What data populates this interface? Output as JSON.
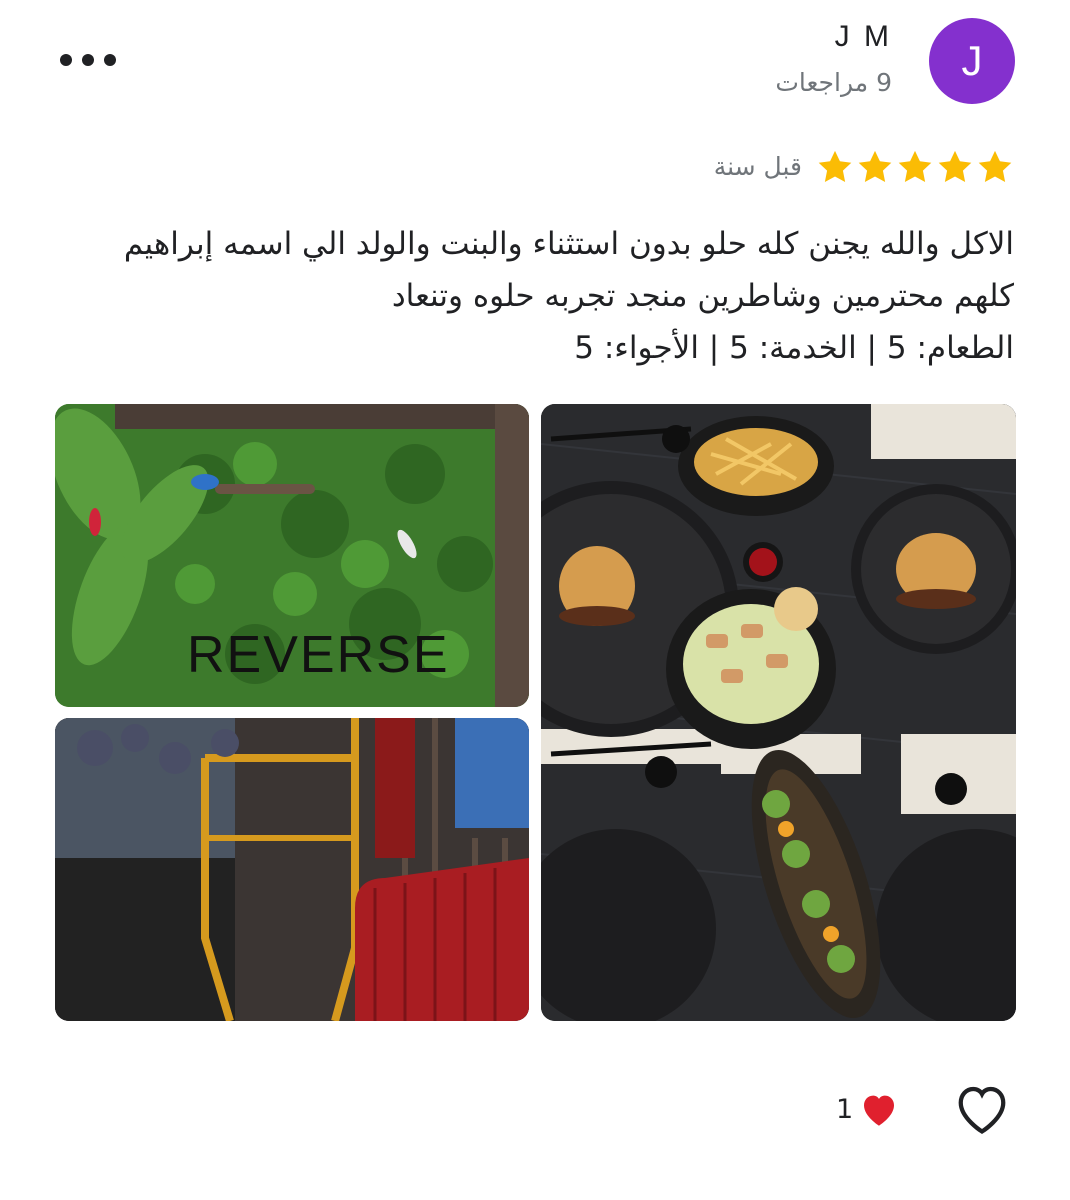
{
  "author": {
    "initial": "J",
    "name": "J M",
    "meta": "9 مراجعات",
    "avatar_color": "#8430ce"
  },
  "actions": {
    "more_icon": "more-horizontal-icon"
  },
  "rating": {
    "stars": 5,
    "max": 5,
    "star_color": "#fbbc04"
  },
  "time": "قبل سنة",
  "review": {
    "line1": "الاكل والله يجنن كله حلو بدون استثناء والبنت والولد الي اسمه إبراهيم",
    "line2": "كلهم محترمين وشاطرين منجد تجربه حلوه وتنعاد",
    "line3": "الطعام: 5 | الخدمة: 5 | الأجواء: 5"
  },
  "photos": {
    "wall_sign": "REVERSE"
  },
  "reactions": {
    "count": "1",
    "heart_icon": "red-heart-icon",
    "like_icon": "heart-outline-icon"
  }
}
